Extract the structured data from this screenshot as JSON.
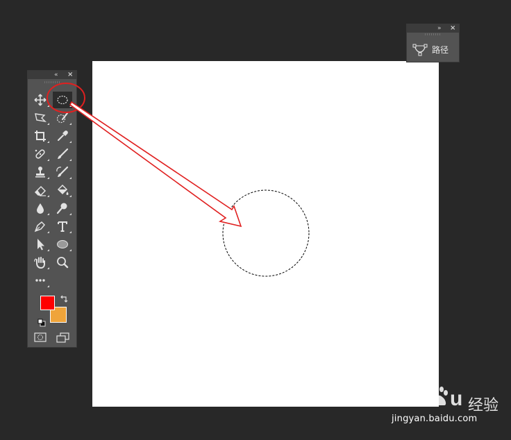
{
  "panels": {
    "paths": {
      "title_expand": "expand-panel",
      "tab_label": "路径"
    },
    "toolbar": {
      "tools_left": [
        "move-tool",
        "polygonal-lasso-tool",
        "crop-tool",
        "spot-healing-brush-tool",
        "clone-stamp-tool",
        "eraser-tool",
        "blur-tool",
        "pen-tool",
        "path-selection-tool",
        "hand-tool",
        "more-tools"
      ],
      "tools_right": [
        "elliptical-marquee-tool",
        "quick-selection-tool",
        "eyedropper-tool",
        "brush-tool",
        "history-brush-tool",
        "paint-bucket-tool",
        "dodge-tool",
        "type-tool",
        "ellipse-shape-tool",
        "zoom-tool"
      ],
      "active_tool": "elliptical-marquee-tool"
    },
    "colors": {
      "foreground": "#ff0000",
      "background": "#efa43a"
    }
  },
  "annotation": {
    "color": "#e02020"
  },
  "watermark": {
    "brand_suffix": "经验",
    "url": "jingyan.baidu.com"
  }
}
